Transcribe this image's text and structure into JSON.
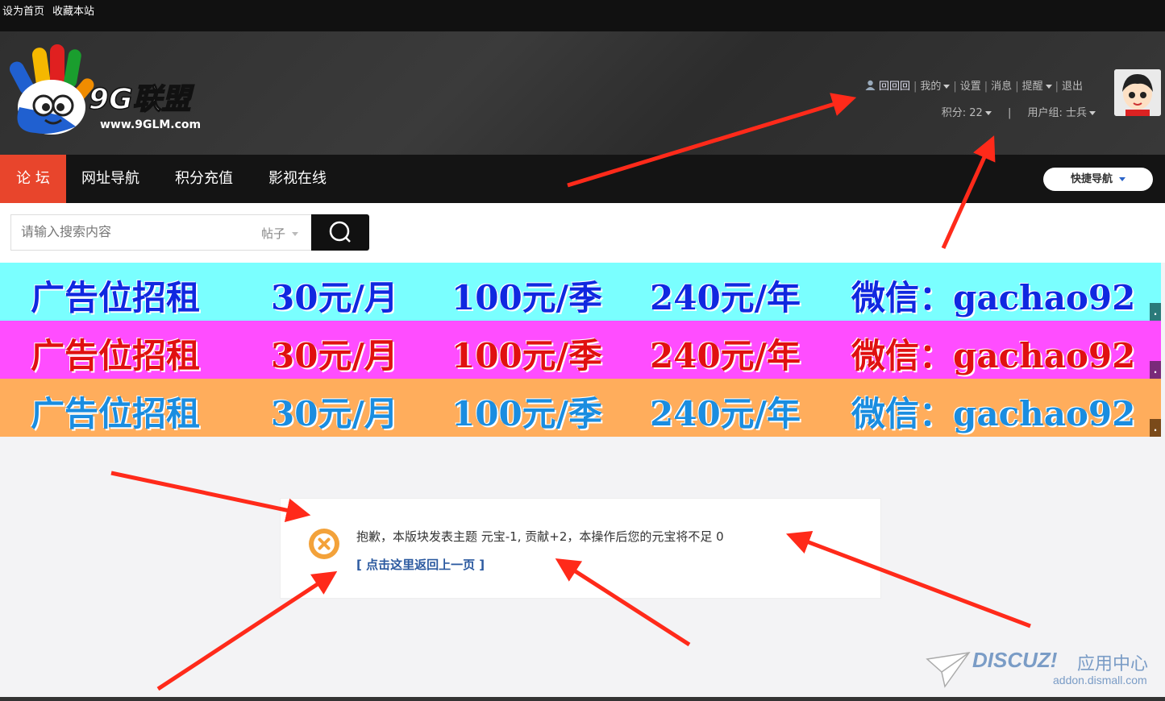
{
  "topbar": {
    "set_home": "设为首页",
    "bookmark": "收藏本站"
  },
  "header": {
    "logo_text": "9G联盟",
    "logo_url_text": "www.9GLM.com",
    "user": {
      "username": "回回回",
      "my": "我的",
      "settings": "设置",
      "messages": "消息",
      "reminders": "提醒",
      "logout": "退出",
      "sep": "|",
      "points": "积分: 22",
      "usergroup": "用户组: 士兵"
    }
  },
  "nav": {
    "items": [
      {
        "label": "论 坛"
      },
      {
        "label": "网址导航"
      },
      {
        "label": "积分充值"
      },
      {
        "label": "影视在线"
      }
    ],
    "quick_nav": "快捷导航"
  },
  "search": {
    "placeholder": "请输入搜索内容",
    "type": "帖子"
  },
  "ads": [
    {
      "parts": [
        "广告位招租",
        "30元/月",
        "100元/季",
        "240元/年",
        "微信：gachao92"
      ],
      "tag": ".",
      "color": "#7affff"
    },
    {
      "parts": [
        "广告位招租",
        "30元/月",
        "100元/季",
        "240元/年",
        "微信：gachao92"
      ],
      "tag": ".",
      "color": "#ff4dff"
    },
    {
      "parts": [
        "广告位招租",
        "30元/月",
        "100元/季",
        "240元/年",
        "微信：gachao92"
      ],
      "tag": ".",
      "color": "#ffad5c"
    }
  ],
  "message": {
    "text": "抱歉，本版块发表主题 元宝-1, 贡献+2，本操作后您的元宝将不足 0",
    "back_link": "[ 点击这里返回上一页 ]"
  },
  "watermark": {
    "brand": "DISCUZ!",
    "label": "应用中心",
    "url": "addon.dismall.com"
  }
}
